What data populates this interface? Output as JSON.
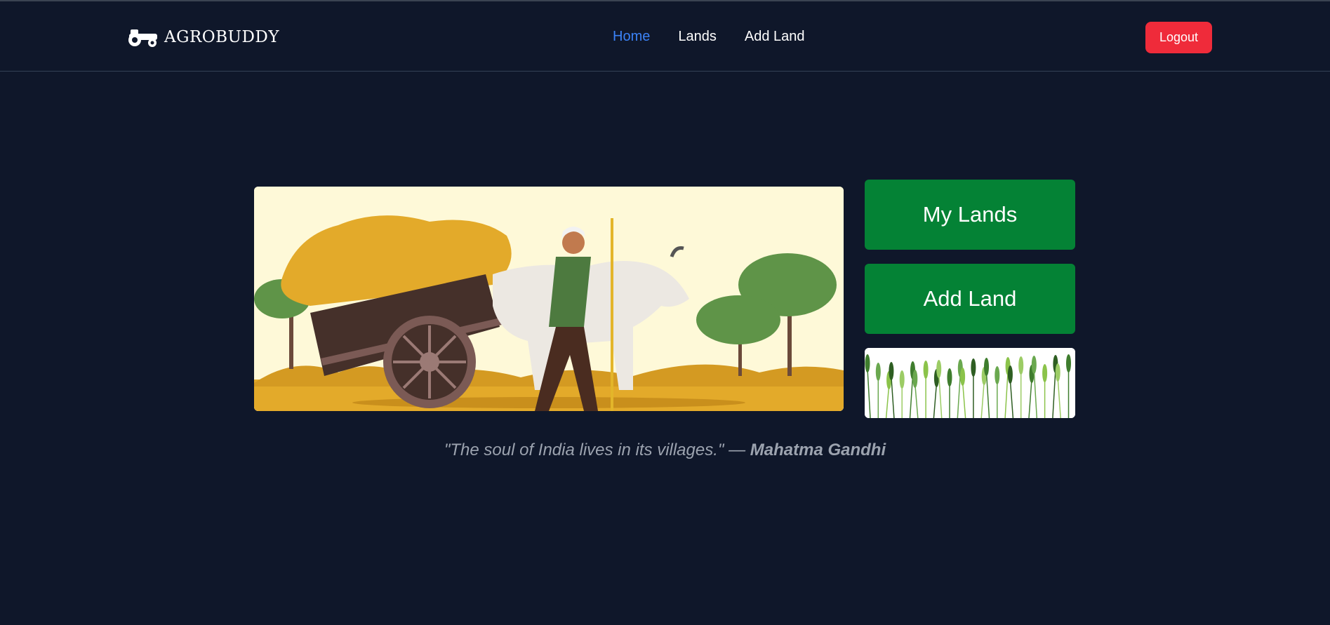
{
  "brand": {
    "name": "AGROBUDDY",
    "logo_icon": "tractor-icon"
  },
  "nav": {
    "links": [
      {
        "label": "Home",
        "active": true
      },
      {
        "label": "Lands",
        "active": false
      },
      {
        "label": "Add Land",
        "active": false
      }
    ],
    "logout_label": "Logout"
  },
  "actions": {
    "my_lands_label": "My Lands",
    "add_land_label": "Add Land"
  },
  "quote": {
    "text": "\"The soul of India lives in its villages.\" —",
    "author": "Mahatma Gandhi"
  },
  "colors": {
    "background": "#0f172a",
    "nav_active": "#3b82f6",
    "logout": "#ef2b3a",
    "action_button": "#048235",
    "quote_text": "#9ca3af"
  }
}
